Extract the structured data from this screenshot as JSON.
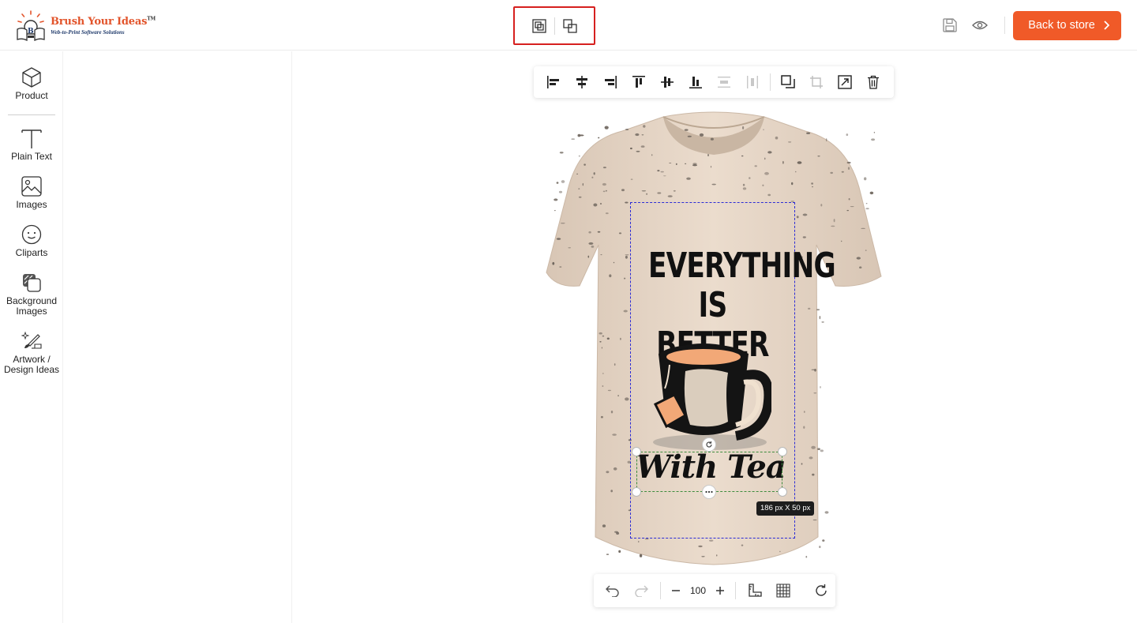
{
  "brand": {
    "name": "Brush Your Ideas",
    "trademark": "TM",
    "tagline": "Web-to-Print Software Solutions"
  },
  "header": {
    "group_button_label": "Group",
    "ungroup_button_label": "Ungroup",
    "save_icon": "save-icon",
    "preview_icon": "eye-icon",
    "back_to_store_label": "Back to store",
    "accent_color": "#f05a28",
    "highlight_color": "#d6201f"
  },
  "sidebar": {
    "items": [
      {
        "label": "Product",
        "icon": "cube-icon"
      },
      {
        "label": "Plain Text",
        "icon": "text-icon"
      },
      {
        "label": "Images",
        "icon": "image-icon"
      },
      {
        "label": "Cliparts",
        "icon": "smiley-icon"
      },
      {
        "label": "Background Images",
        "icon": "layers-icon"
      },
      {
        "label": "Artwork / Design Ideas",
        "icon": "brush-icon"
      }
    ]
  },
  "toolbar": {
    "buttons": [
      "align-left-icon",
      "align-center-icon",
      "align-right-icon",
      "align-top-icon",
      "align-middle-icon",
      "align-bottom-icon",
      "distribute-horizontal-icon",
      "distribute-vertical-icon",
      "duplicate-icon",
      "crop-icon",
      "resize-icon",
      "delete-icon"
    ]
  },
  "canvas": {
    "design_line1": "EVERYTHING",
    "design_line2": "IS BETTER",
    "design_script": "With Tea",
    "selection_size": "186 px X 50 px",
    "selection_color": "#3d8c3d",
    "print_area_color": "#2b2bd6"
  },
  "bottom": {
    "zoom": "100",
    "buttons": [
      "undo-icon",
      "redo-icon",
      "zoom-out-icon",
      "zoom-in-icon",
      "ruler-icon",
      "grid-icon",
      "reset-icon"
    ]
  }
}
